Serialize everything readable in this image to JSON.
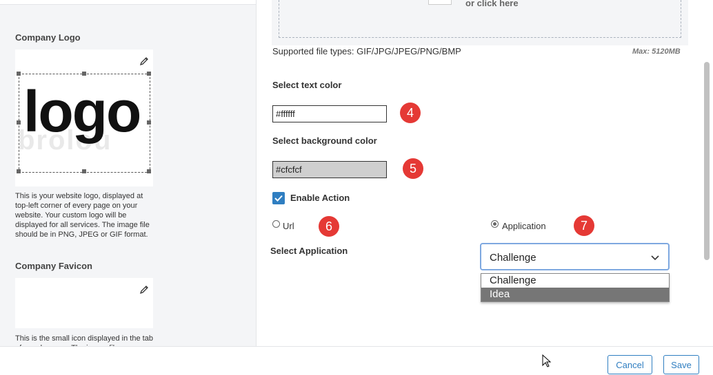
{
  "left_panel": {
    "company_logo_title": "Company Logo",
    "logo_text": "logo",
    "logo_ghost_text": "brolou",
    "logo_description": "This is your website logo, displayed at top-left corner of every page on your website. Your custom logo will be displayed for all services. The image file should be in PNG, JPEG or GIF format.",
    "company_favicon_title": "Company Favicon",
    "favicon_description": "This is the small icon displayed in the tab of your browser. The image file"
  },
  "upload": {
    "click_text": "or click here",
    "supported_types": "Supported file types: GIF/JPG/JPEG/PNG/BMP",
    "max_size": "Max: 5120MB"
  },
  "form": {
    "text_color_label": "Select text color",
    "text_color_value": "#ffffff",
    "bg_color_label": "Select background color",
    "bg_color_value": "#cfcfcf",
    "enable_action_label": "Enable Action",
    "enable_action_checked": true,
    "radio_url_label": "Url",
    "radio_application_label": "Application",
    "selected_radio": "Application",
    "select_application_label": "Select Application",
    "select_value": "Challenge",
    "options": [
      "Challenge",
      "Idea"
    ],
    "highlighted_option": "Idea"
  },
  "badges": {
    "b4": "4",
    "b5": "5",
    "b6": "6",
    "b7": "7"
  },
  "footer": {
    "cancel_label": "Cancel",
    "save_label": "Save"
  },
  "colors": {
    "accent": "#2f7ec1",
    "badge": "#e53935",
    "bg_color_swatch": "#cfcfcf",
    "highlight": "#767676"
  }
}
